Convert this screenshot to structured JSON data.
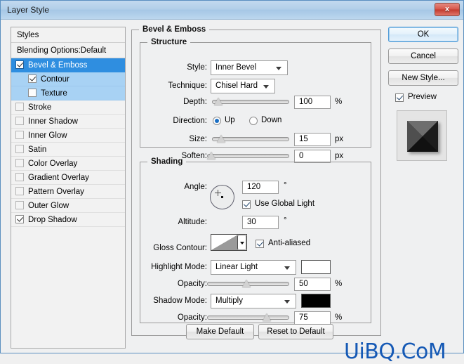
{
  "window": {
    "title": "Layer Style",
    "close_label": "x"
  },
  "styles_panel": {
    "header": "Styles",
    "blending_options": "Blending Options:Default",
    "items": [
      {
        "label": "Bevel & Emboss",
        "checked": true,
        "selected": true,
        "sub": false,
        "dim": false
      },
      {
        "label": "Contour",
        "checked": true,
        "selected": false,
        "sub": true,
        "dim": false
      },
      {
        "label": "Texture",
        "checked": false,
        "selected": false,
        "sub": true,
        "dim": false
      },
      {
        "label": "Stroke",
        "checked": false,
        "selected": false,
        "sub": false,
        "dim": true
      },
      {
        "label": "Inner Shadow",
        "checked": false,
        "selected": false,
        "sub": false,
        "dim": true
      },
      {
        "label": "Inner Glow",
        "checked": false,
        "selected": false,
        "sub": false,
        "dim": true
      },
      {
        "label": "Satin",
        "checked": false,
        "selected": false,
        "sub": false,
        "dim": true
      },
      {
        "label": "Color Overlay",
        "checked": false,
        "selected": false,
        "sub": false,
        "dim": true
      },
      {
        "label": "Gradient Overlay",
        "checked": false,
        "selected": false,
        "sub": false,
        "dim": true
      },
      {
        "label": "Pattern Overlay",
        "checked": false,
        "selected": false,
        "sub": false,
        "dim": true
      },
      {
        "label": "Outer Glow",
        "checked": false,
        "selected": false,
        "sub": false,
        "dim": true
      },
      {
        "label": "Drop Shadow",
        "checked": true,
        "selected": false,
        "sub": false,
        "dim": false
      }
    ]
  },
  "main": {
    "group_title": "Bevel & Emboss",
    "structure": {
      "title": "Structure",
      "style_label": "Style:",
      "style_value": "Inner Bevel",
      "technique_label": "Technique:",
      "technique_value": "Chisel Hard",
      "depth_label": "Depth:",
      "depth_value": "100",
      "depth_unit": "%",
      "direction_label": "Direction:",
      "direction_up": "Up",
      "direction_down": "Down",
      "direction_selected": "Up",
      "size_label": "Size:",
      "size_value": "15",
      "size_unit": "px",
      "soften_label": "Soften:",
      "soften_value": "0",
      "soften_unit": "px"
    },
    "shading": {
      "title": "Shading",
      "angle_label": "Angle:",
      "angle_value": "120",
      "angle_unit": "°",
      "use_global_light": "Use Global Light",
      "use_global_light_checked": true,
      "altitude_label": "Altitude:",
      "altitude_value": "30",
      "altitude_unit": "°",
      "gloss_contour_label": "Gloss Contour:",
      "anti_aliased": "Anti-aliased",
      "anti_aliased_checked": true,
      "highlight_mode_label": "Highlight Mode:",
      "highlight_mode_value": "Linear Light",
      "highlight_color": "#ffffff",
      "highlight_opacity_label": "Opacity:",
      "highlight_opacity_value": "50",
      "highlight_opacity_unit": "%",
      "shadow_mode_label": "Shadow Mode:",
      "shadow_mode_value": "Multiply",
      "shadow_color": "#000000",
      "shadow_opacity_label": "Opacity:",
      "shadow_opacity_value": "75",
      "shadow_opacity_unit": "%"
    }
  },
  "right_panel": {
    "ok": "OK",
    "cancel": "Cancel",
    "new_style": "New Style...",
    "preview_label": "Preview",
    "preview_checked": true
  },
  "bottom": {
    "make_default": "Make Default",
    "reset_to_default": "Reset to Default"
  },
  "watermark": "UiBQ.CoM",
  "colors": {
    "selection": "#2f8ee0",
    "sub_selection": "#a8d2f4",
    "titlebar": "#b2cfe9",
    "watermark": "#1559b5"
  }
}
